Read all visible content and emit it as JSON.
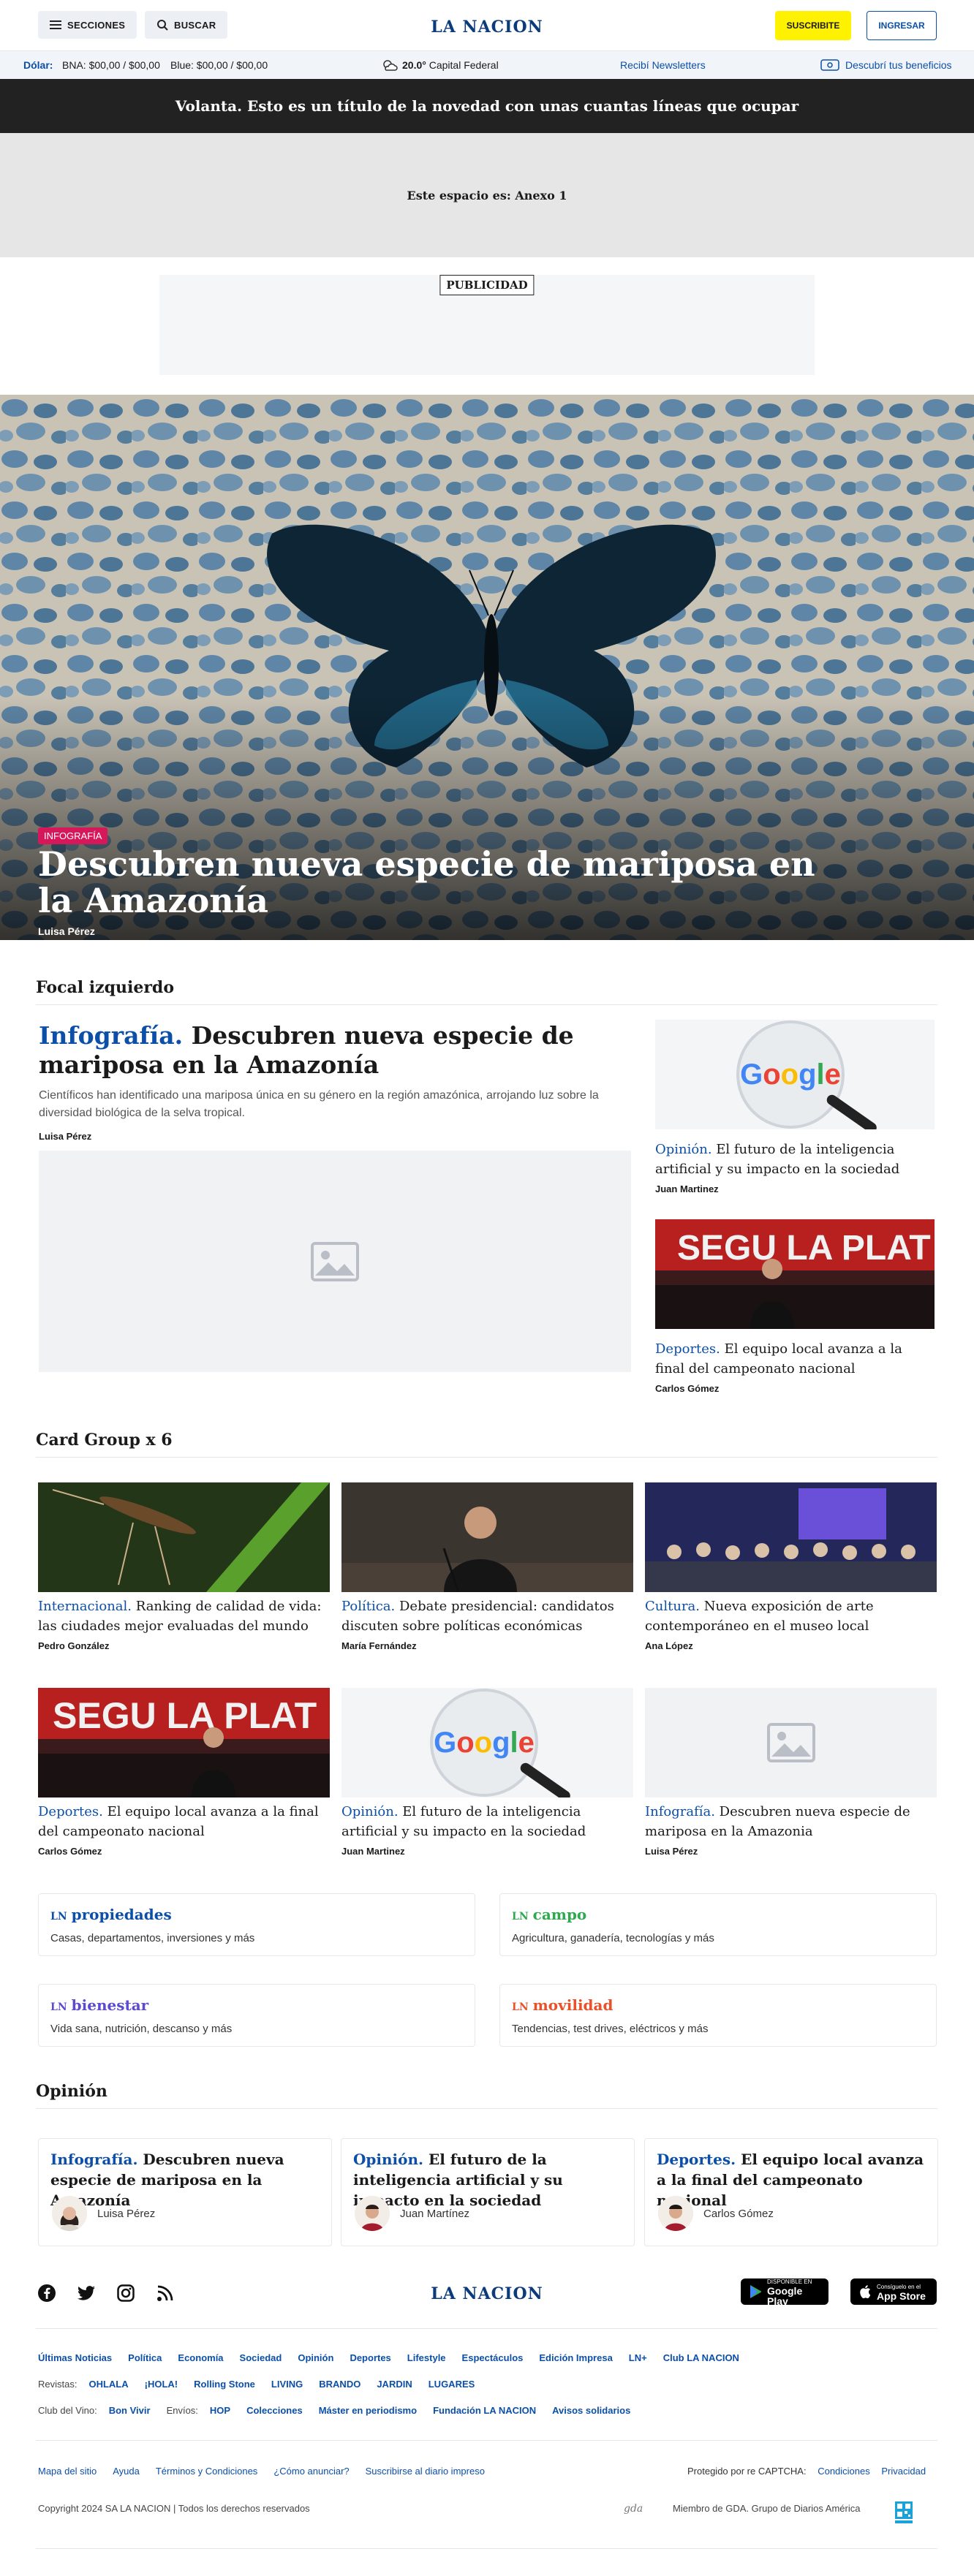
{
  "header": {
    "sections_label": "SECCIONES",
    "search_label": "BUSCAR",
    "logo": "LA NACION",
    "subscribe_label": "SUSCRIBITE",
    "login_label": "INGRESAR"
  },
  "ticker": {
    "dollar_label": "Dólar:",
    "bna": "BNA: $00,00 / $00,00",
    "blue": "Blue: $00,00 / $00,00",
    "temp": "20.0°",
    "city": "Capital Federal",
    "newsletters": "Recibí Newsletters",
    "benefits": "Descubrí tus beneficios"
  },
  "volanta": "Volanta. Esto es un título de la novedad con unas cuantas líneas que ocupar",
  "anexo": "Este espacio es: Anexo 1",
  "publicidad": "PUBLICIDAD",
  "hero": {
    "tag": "INFOGRAFÍA",
    "title": "Descubren nueva especie de mariposa en la Amazonía",
    "author": "Luisa Pérez"
  },
  "focal": {
    "section": "Focal izquierdo",
    "main": {
      "kicker": "Infografía.",
      "title": "Descubren nueva especie de mariposa en la Amazonía",
      "summary": "Científicos han identificado una mariposa única en su género en la región amazónica, arrojando luz sobre la diversidad biológica de la selva tropical.",
      "author": "Luisa Pérez"
    },
    "side": [
      {
        "kicker": "Opinión.",
        "title": "El futuro de la inteligencia artificial y su impacto en la sociedad",
        "author": "Juan Martinez"
      },
      {
        "kicker": "Deportes.",
        "title": "El equipo local avanza a la final del campeonato nacional",
        "author": "Carlos Gómez"
      }
    ]
  },
  "cards": {
    "section": "Card Group x 6",
    "items": [
      {
        "kicker": "Internacional.",
        "title": "Ranking de calidad de vida: las ciudades mejor evaluadas del mundo",
        "author": "Pedro González"
      },
      {
        "kicker": "Política.",
        "title": "Debate presidencial: candidatos discuten sobre políticas económicas",
        "author": "María Fernández"
      },
      {
        "kicker": "Cultura.",
        "title": "Nueva exposición de arte contemporáneo en el museo local",
        "author": "Ana López"
      },
      {
        "kicker": "Deportes.",
        "title": "El equipo local avanza a la final del campeonato nacional",
        "author": "Carlos Gómez"
      },
      {
        "kicker": "Opinión.",
        "title": "El futuro de la inteligencia artificial y su impacto en la sociedad",
        "author": "Juan Martinez"
      },
      {
        "kicker": "Infografía.",
        "title": "Descubren nueva especie de mariposa en la Amazonia",
        "author": "Luisa Pérez"
      }
    ]
  },
  "brands": [
    {
      "prefix": "LN",
      "name": "propiedades",
      "desc": "Casas, departamentos, inversiones y más",
      "color": "#0b4fa8"
    },
    {
      "prefix": "LN",
      "name": "campo",
      "desc": "Agricultura, ganadería, tecnologías y más",
      "color": "#2fa84f"
    },
    {
      "prefix": "LN",
      "name": "bienestar",
      "desc": "Vida sana, nutrición, descanso y más",
      "color": "#5b4bd1"
    },
    {
      "prefix": "LN",
      "name": "movilidad",
      "desc": "Tendencias, test drives, eléctricos y más",
      "color": "#e8512a"
    }
  ],
  "opinion": {
    "section": "Opinión",
    "items": [
      {
        "kicker": "Infografía.",
        "title": "Descubren nueva especie de mariposa en la Amazonía",
        "author": "Luisa Pérez"
      },
      {
        "kicker": "Opinión.",
        "title": "El futuro de la inteligencia artificial y su impacto en la sociedad",
        "author": "Juan Martínez"
      },
      {
        "kicker": "Deportes.",
        "title": "El equipo local avanza a la final del campeonato nacional",
        "author": "Carlos Gómez"
      }
    ]
  },
  "footer": {
    "logo": "LA NACION",
    "google_play_small": "DISPONIBLE EN",
    "google_play": "Google Play",
    "app_store_small": "Consíguelo en el",
    "app_store": "App Store",
    "links1": [
      "Últimas Noticias",
      "Política",
      "Economía",
      "Sociedad",
      "Opinión",
      "Deportes",
      "Lifestyle",
      "Espectáculos",
      "Edición Impresa",
      "LN+",
      "Club LA NACION"
    ],
    "revistas_label": "Revistas:",
    "revistas": [
      "OHLALA",
      "¡HOLA!",
      "Rolling Stone",
      "LIVING",
      "BRANDO",
      "JARDIN",
      "LUGARES"
    ],
    "club_label": "Club del Vino:",
    "club": "Bon Vivir",
    "envios_label": "Envíos:",
    "links3": [
      "HOP",
      "Colecciones",
      "Máster en periodismo",
      "Fundación LA NACION",
      "Avisos solidarios"
    ],
    "bottom": [
      "Mapa del sitio",
      "Ayuda",
      "Términos y Condiciones",
      "¿Cómo anunciar?",
      "Suscribirse al diario impreso"
    ],
    "captcha": "Protegido por re CAPTCHA:",
    "conditions": "Condiciones",
    "privacy": "Privacidad",
    "copyright": "Copyright 2024 SA LA NACION | Todos los derechos reservados",
    "gda": "Miembro de GDA. Grupo de Diarios América"
  }
}
